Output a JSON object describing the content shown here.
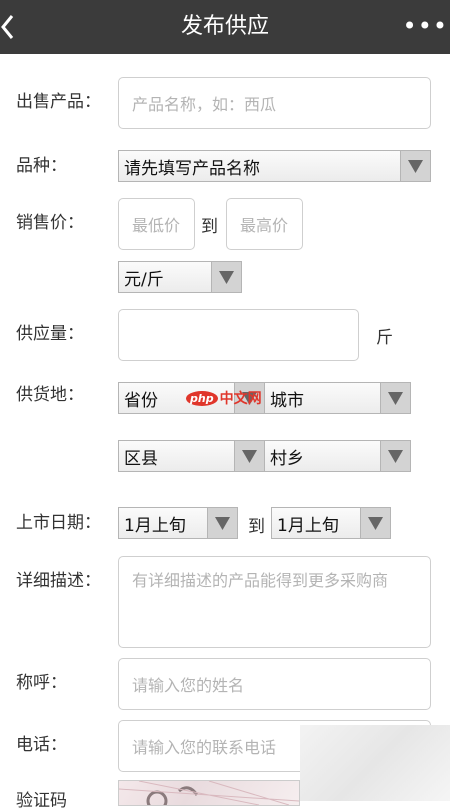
{
  "header": {
    "title": "发布供应",
    "back_icon": "chevron-left-icon",
    "more_label": "•••"
  },
  "form": {
    "product": {
      "label": "出售产品：",
      "placeholder": "产品名称，如：西瓜"
    },
    "variety": {
      "label": "品种：",
      "value": "请先填写产品名称"
    },
    "price": {
      "label": "销售价：",
      "min_placeholder": "最低价",
      "to": "到",
      "max_placeholder": "最高价",
      "unit_value": "元/斤"
    },
    "supply": {
      "label": "供应量：",
      "unit": "斤"
    },
    "origin": {
      "label": "供货地：",
      "province": "省份",
      "city": "城市",
      "county": "区县",
      "village": "村乡"
    },
    "market_date": {
      "label": "上市日期：",
      "from": "1月上旬",
      "to": "到",
      "until": "1月上旬"
    },
    "description": {
      "label": "详细描述：",
      "placeholder": "有详细描述的产品能得到更多采购商"
    },
    "contact_name": {
      "label": "称呼：",
      "placeholder": "请输入您的姓名"
    },
    "phone": {
      "label": "电话：",
      "placeholder": "请输入您的联系电话"
    },
    "captcha": {
      "label": "验证码"
    }
  },
  "watermark": {
    "badge": "php",
    "text": "中文网"
  },
  "colors": {
    "topbar": "#3b3b3b",
    "border": "#cfcfcf",
    "placeholder": "#b4b4b4",
    "select_arrow_bg": "#d3d3d3"
  }
}
